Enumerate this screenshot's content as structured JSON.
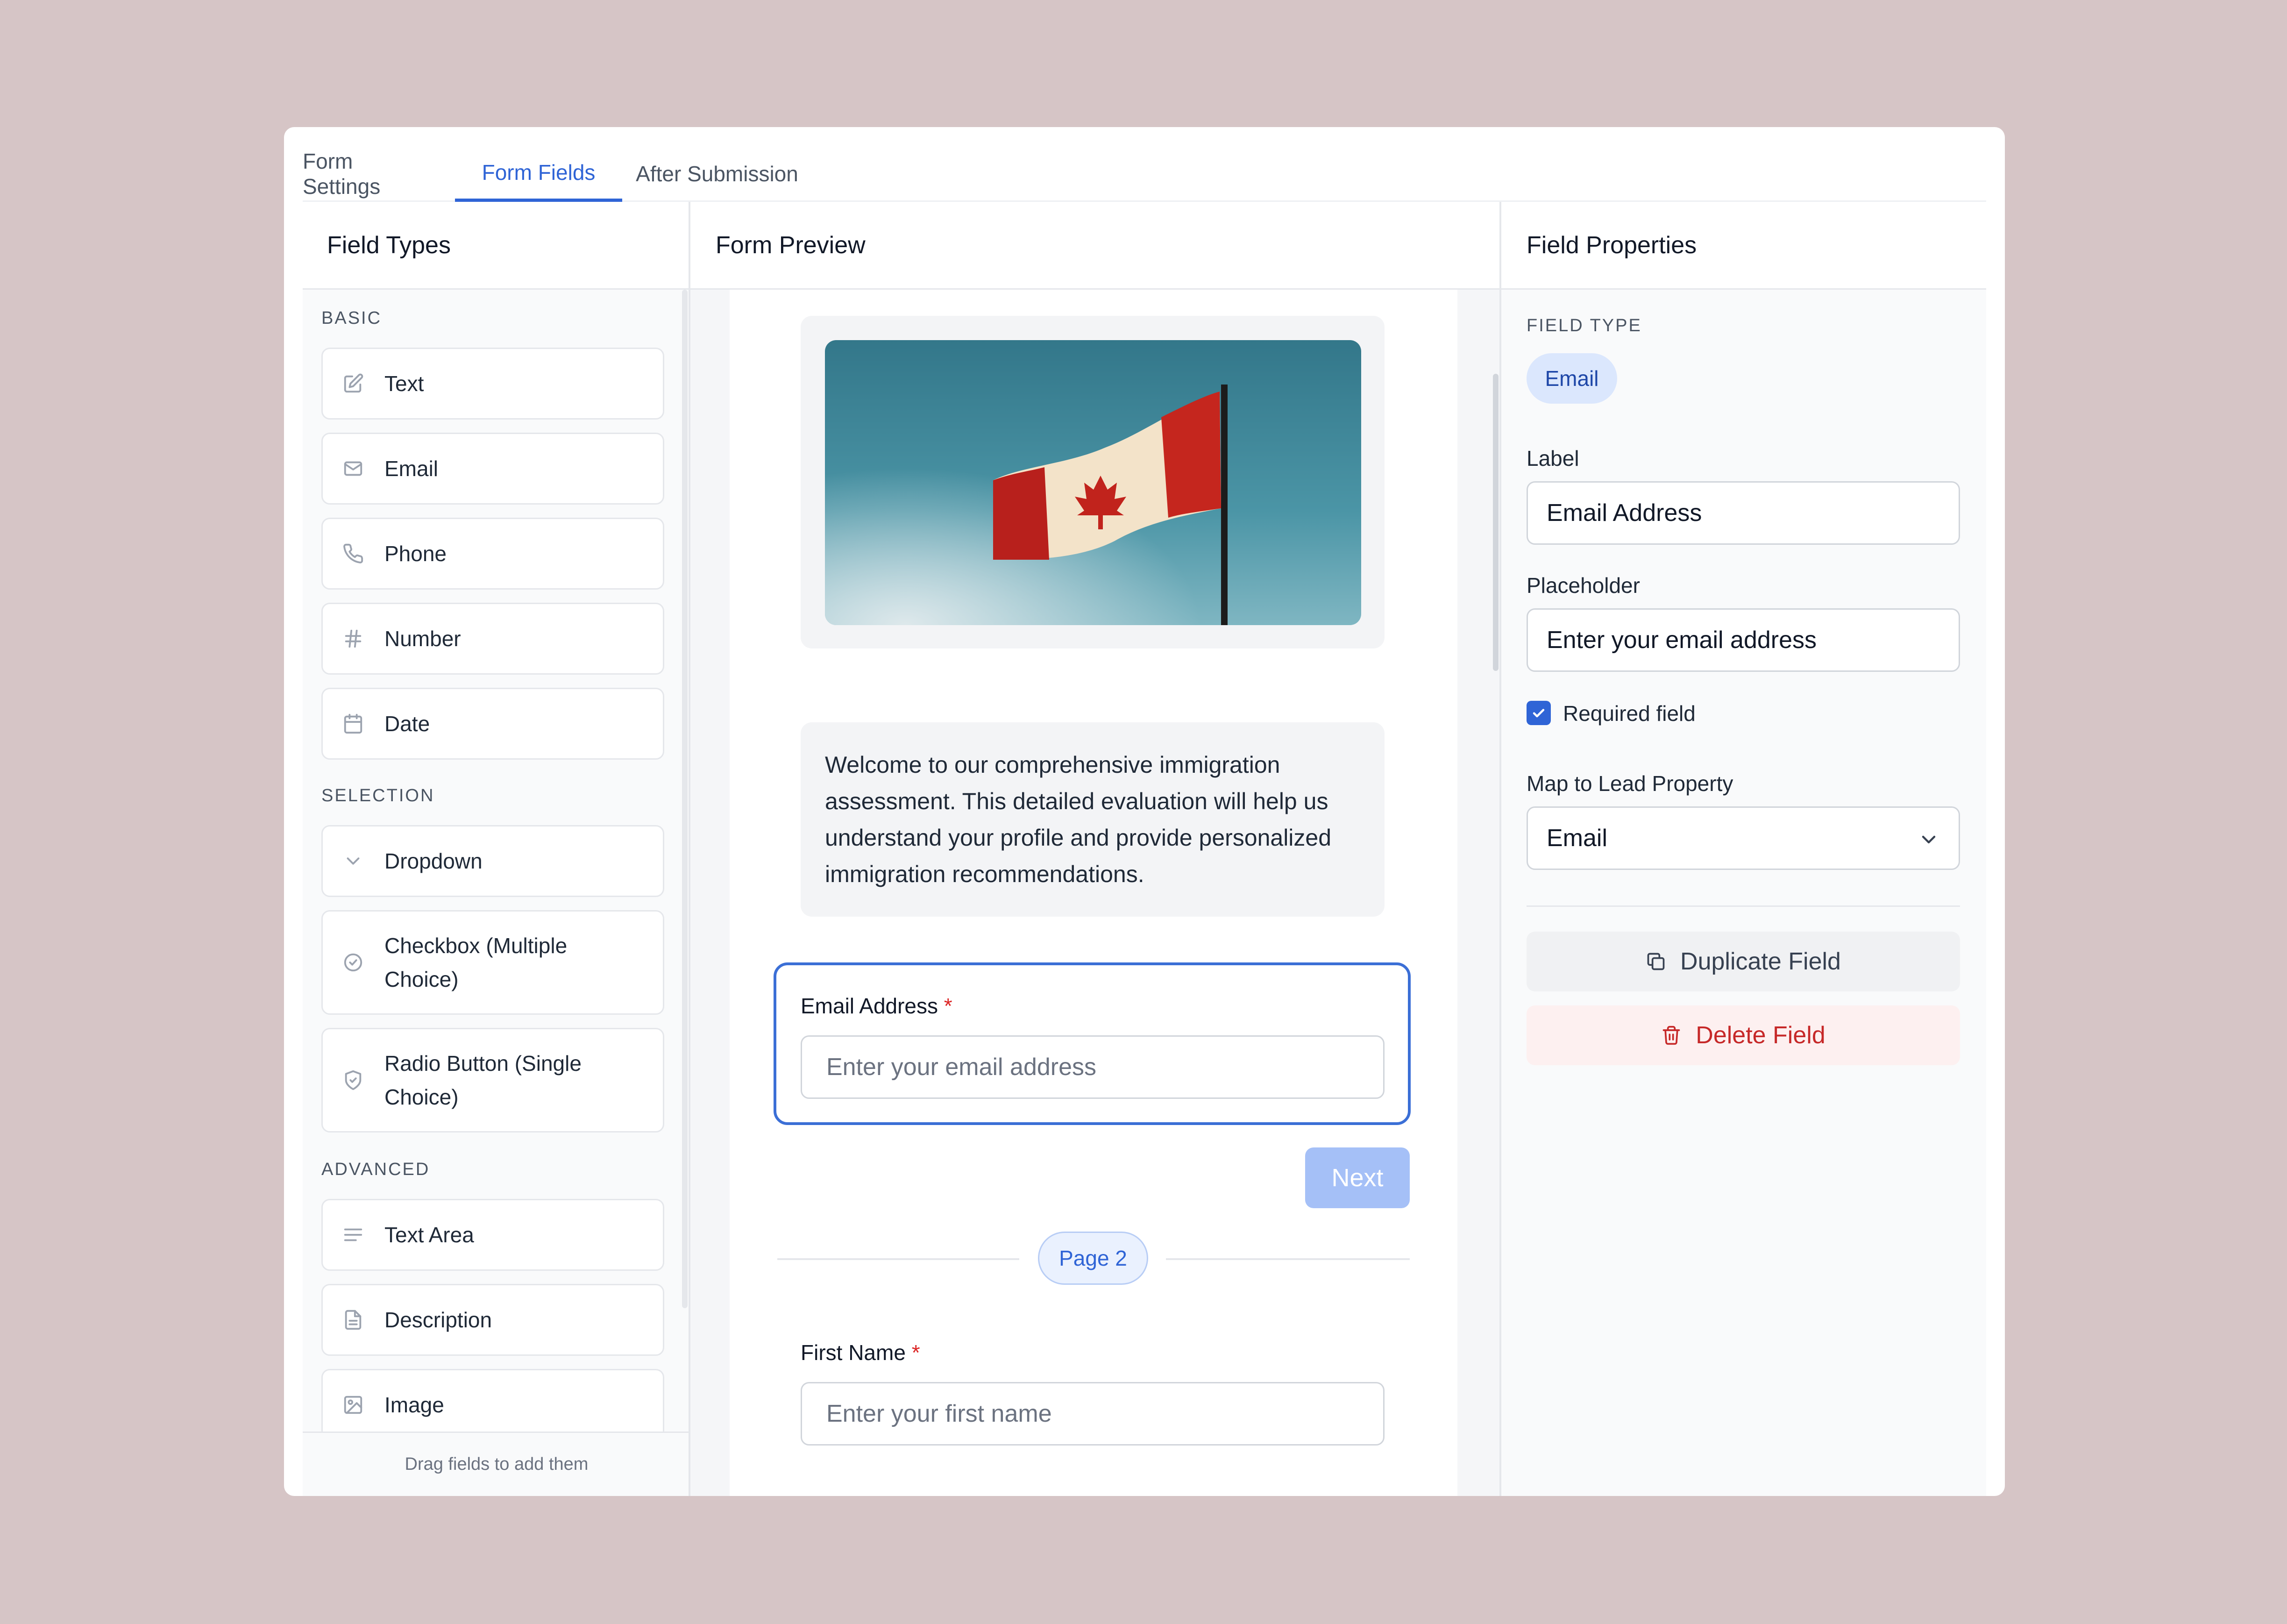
{
  "tabs": [
    {
      "label": "Form Settings"
    },
    {
      "label": "Form Fields"
    },
    {
      "label": "After Submission"
    }
  ],
  "field_types": {
    "title": "Field Types",
    "sections": {
      "basic": "BASIC",
      "selection": "SELECTION",
      "advanced": "ADVANCED"
    },
    "items": [
      {
        "label": "Text",
        "icon": "edit-icon"
      },
      {
        "label": "Email",
        "icon": "mail-icon"
      },
      {
        "label": "Phone",
        "icon": "phone-icon"
      },
      {
        "label": "Number",
        "icon": "hash-icon"
      },
      {
        "label": "Date",
        "icon": "calendar-icon"
      },
      {
        "label": "Dropdown",
        "icon": "chevron-down-icon"
      },
      {
        "label": "Checkbox (Multiple Choice)",
        "icon": "check-circle-icon"
      },
      {
        "label": "Radio Button (Single Choice)",
        "icon": "shield-check-icon"
      },
      {
        "label": "Text Area",
        "icon": "align-left-icon"
      },
      {
        "label": "Description",
        "icon": "file-text-icon"
      },
      {
        "label": "Image",
        "icon": "image-icon"
      }
    ],
    "footer": "Drag fields to add them"
  },
  "preview": {
    "title": "Form Preview",
    "image_alt": "Canadian flag",
    "description": "Welcome to our comprehensive immigration assessment. This detailed evaluation will help us understand your profile and provide personalized immigration recommendations.",
    "email_field": {
      "label": "Email Address",
      "required_mark": "*",
      "placeholder": "Enter your email address"
    },
    "next_button": "Next",
    "page_pill": "Page 2",
    "first_name_field": {
      "label": "First Name",
      "required_mark": "*",
      "placeholder": "Enter your first name"
    }
  },
  "properties": {
    "title": "Field Properties",
    "field_type_label": "FIELD TYPE",
    "field_type_value": "Email",
    "label_label": "Label",
    "label_value": "Email Address",
    "placeholder_label": "Placeholder",
    "placeholder_value": "Enter your email address",
    "required_label": "Required field",
    "required_checked": true,
    "map_label": "Map to Lead Property",
    "map_value": "Email",
    "duplicate_button": "Duplicate Field",
    "delete_button": "Delete Field"
  },
  "colors": {
    "accent": "#2f64d6",
    "background": "#d6c5c6",
    "danger": "#c62828",
    "danger_bg": "#fdf0f0"
  }
}
